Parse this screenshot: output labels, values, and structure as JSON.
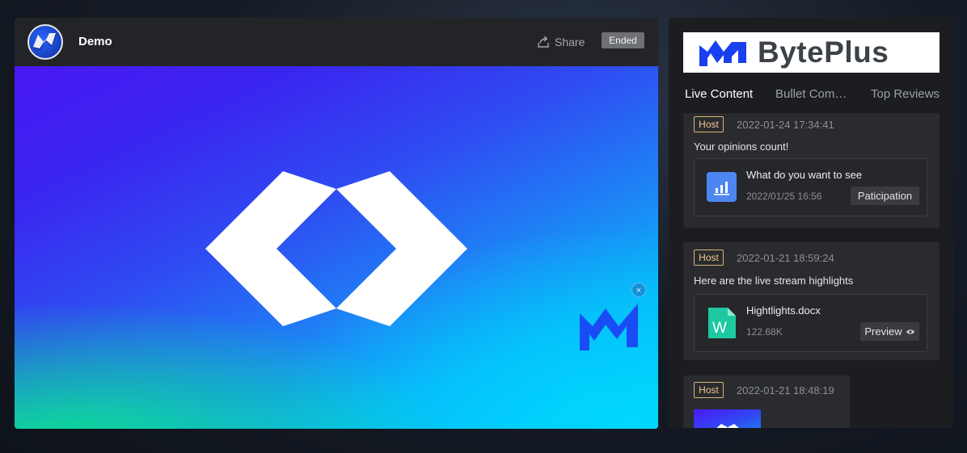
{
  "player": {
    "channel_name": "Demo",
    "share_label": "Share",
    "status_badge": "Ended"
  },
  "side": {
    "brand_name": "BytePlus",
    "tabs": [
      {
        "label": "Live Content",
        "active": true
      },
      {
        "label": "Bullet Com…",
        "active": false
      },
      {
        "label": "Top Reviews",
        "active": false
      }
    ],
    "cards": [
      {
        "tag": "Host",
        "time": "2022-01-24 17:34:41",
        "text": "Your opinions count!",
        "attachment": {
          "icon": "poll-icon",
          "title": "What do you want to see",
          "subtitle": "2022/01/25 16:56",
          "button": "Paticipation"
        }
      },
      {
        "tag": "Host",
        "time": "2022-01-21 18:59:24",
        "text": "Here are the live stream highlights",
        "attachment": {
          "icon": "word-doc-icon",
          "title": "Hightlights.docx",
          "subtitle": "122.68K",
          "button": "Preview"
        }
      },
      {
        "tag": "Host",
        "time": "2022-01-21 18:48:19",
        "image": "stream-thumbnail"
      }
    ]
  },
  "colors": {
    "accent_tag": "#efc690",
    "panel_bg": "#1c1d20",
    "card_bg": "#2a2b2e",
    "poll_blue": "#4d86f1",
    "doc_green": "#1ec8a0"
  }
}
